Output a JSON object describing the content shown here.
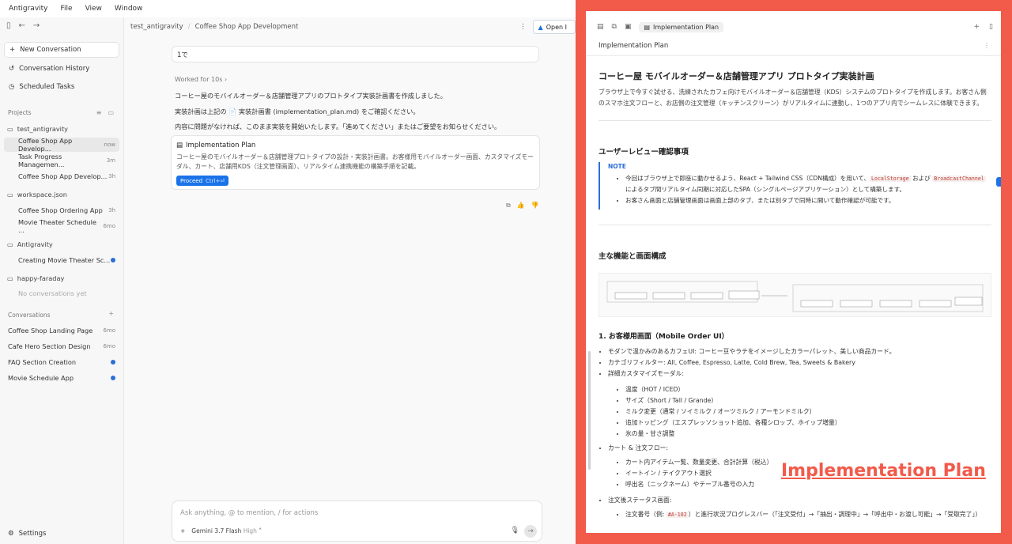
{
  "menu": {
    "brand": "Antigravity",
    "items": [
      "File",
      "View",
      "Window"
    ]
  },
  "sidebar": {
    "new_conversation": "New Conversation",
    "conversation_history": "Conversation History",
    "scheduled_tasks": "Scheduled Tasks",
    "projects_heading": "Projects",
    "projects": [
      {
        "name": "test_antigravity",
        "items": [
          {
            "label": "Coffee Shop App Develop...",
            "time": "now",
            "active": true
          },
          {
            "label": "Task Progress Managemen...",
            "time": "3m"
          },
          {
            "label": "Coffee Shop App Develop...",
            "time": "3h"
          }
        ]
      },
      {
        "name": "workspace.json",
        "items": [
          {
            "label": "Coffee Shop Ordering App",
            "time": "3h"
          },
          {
            "label": "Movie Theater Schedule ...",
            "time": "6mo"
          }
        ]
      },
      {
        "name": "Antigravity",
        "items": [
          {
            "label": "Creating Movie Theater Sc...",
            "time": "",
            "dot": true
          }
        ]
      },
      {
        "name": "happy-faraday",
        "items": [
          {
            "label": "No conversations yet",
            "time": "",
            "muted": true
          }
        ]
      }
    ],
    "conversations_heading": "Conversations",
    "conversations": [
      {
        "label": "Coffee Shop Landing Page",
        "time": "6mo"
      },
      {
        "label": "Cafe Hero Section Design",
        "time": "6mo"
      },
      {
        "label": "FAQ Section Creation",
        "dot": true
      },
      {
        "label": "Movie Schedule App",
        "dot": true
      }
    ],
    "settings": "Settings"
  },
  "main": {
    "breadcrumb": [
      "test_antigravity",
      "Coffee Shop App Development"
    ],
    "open_button": "Open I",
    "user_message": "1で",
    "worked_for": "Worked for 10s",
    "paragraphs": [
      "コーヒー屋のモバイルオーダー＆店舗管理アプリのプロトタイプ実装計画書を作成しました。",
      "実装計画は上記の 📄 実装計画書 (implementation_plan.md) をご確認ください。",
      "内容に問題がなければ、このまま実装を開始いたします。「進めてください」またはご要望をお知らせください。"
    ],
    "plan_card": {
      "title": "Implementation Plan",
      "description": "コーヒー屋のモバイルオーダー＆店舗管理プロトタイプの設計・実装計画書。お客様用モバイルオーダー画面、カスタマイズモーダル、カート、店舗用KDS（注文管理画面）、リアルタイム連携機能の構築手順を記載。",
      "proceed": "Proceed",
      "shortcut": "Ctrl+⏎"
    },
    "composer": {
      "placeholder": "Ask anything, @ to mention, / for actions",
      "model": "Gemini 3.7 Flash",
      "mode": "High"
    }
  },
  "panel": {
    "tab_label": "Implementation Plan",
    "title": "Implementation Plan",
    "h1": "コーヒー屋 モバイルオーダー＆店舗管理アプリ プロトタイプ実装計画",
    "lead": "ブラウザ上で今すぐ試せる、洗練されたカフェ向けモバイルオーダー＆店舗管理（KDS）システムのプロトタイプを作成します。お客さん側のスマホ注文フローと、お店側の注文管理（キッチンスクリーン）がリアルタイムに連動し、1つのアプリ内でシームレスに体験できます。",
    "review_heading": "ユーザーレビュー確認事項",
    "note_label": "NOTE",
    "note_items": [
      "今回はブラウザ上で即座に動かせるよう、React + Tailwind CSS（CDN構成）を用いて、LocalStorage および BroadcastChannel によるタブ間リアルタイム同期に対応したSPA（シングルページアプリケーション）として構築します。",
      "お客さん画面と店舗管理画面は画面上部のタブ、または別タブで同時に開いて動作確認が可能です。"
    ],
    "features_heading": "主な機能と画面構成",
    "section1": "1. お客様用画面（Mobile Order UI）",
    "list1": [
      "モダンで温かみのあるカフェUI: コーヒー豆やラテをイメージしたカラーパレット、美しい商品カード。",
      "カテゴリフィルター: All, Coffee, Espresso, Latte, Cold Brew, Tea, Sweets & Bakery",
      "詳細カスタマイズモーダル:"
    ],
    "custom_options": [
      "温度（HOT / ICED）",
      "サイズ（Short / Tall / Grande）",
      "ミルク変更（通常 / ソイミルク / オーツミルク / アーモンドミルク）",
      "追加トッピング（エスプレッソショット追加、各種シロップ、ホイップ増量）",
      "氷の量・甘さ調整"
    ],
    "cart_heading": "カート & 注文フロー:",
    "cart_items": [
      "カート内アイテム一覧、数量変更、合計計算（税込）",
      "イートイン / テイクアウト選択",
      "呼出名（ニックネーム）やテーブル番号の入力"
    ],
    "status_heading": "注文後ステータス画面:",
    "status_items": [
      "注文番号（例: #A-102）と進行状況プログレスバー（「注文受付」→「抽出・調理中」→「呼出中・お渡し可能」→「受取完了」）"
    ]
  },
  "overlay_label": "Implementation Plan",
  "colors": {
    "frame": "#f25a4a",
    "accent": "#1a73e8"
  }
}
